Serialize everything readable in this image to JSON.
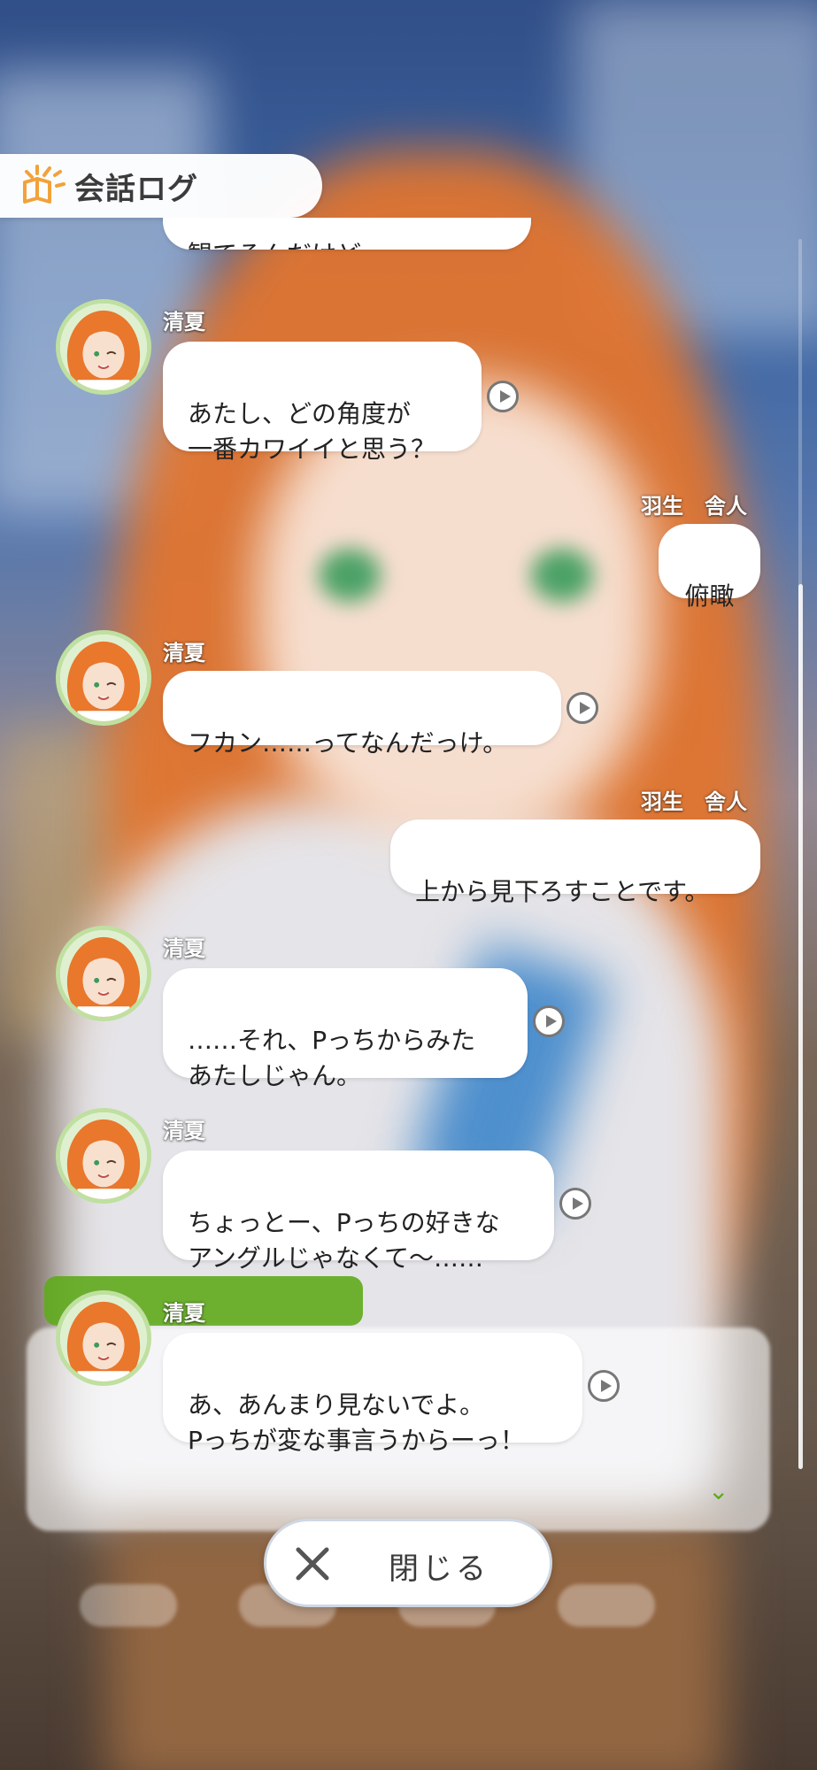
{
  "header": {
    "title": "会話ログ",
    "icon": "conversation-log-icon",
    "accent": "#f2a23a"
  },
  "messages": [
    {
      "speaker": "",
      "side": "left",
      "text": "観てるんだけど",
      "partial": true,
      "voice": false
    },
    {
      "speaker": "清夏",
      "side": "left",
      "text": "あたし、どの角度が\n一番カワイイと思う？",
      "voice": true
    },
    {
      "speaker": "羽生　舎人",
      "side": "right",
      "text": "俯瞰",
      "voice": false
    },
    {
      "speaker": "清夏",
      "side": "left",
      "text": "フカン……ってなんだっけ。",
      "voice": true
    },
    {
      "speaker": "羽生　舎人",
      "side": "right",
      "text": "上から見下ろすことです。",
      "voice": false
    },
    {
      "speaker": "清夏",
      "side": "left",
      "text": "……それ、Pっちからみた\nあたしじゃん。",
      "voice": true
    },
    {
      "speaker": "清夏",
      "side": "left",
      "text": "ちょっとー、Pっちの好きな\nアングルじゃなくて～……",
      "voice": true
    },
    {
      "speaker": "清夏",
      "side": "left",
      "text": "あ、あんまり見ないでよ。\nPっちが変な事言うからーっ！",
      "voice": true
    }
  ],
  "close_button": {
    "label": "閉じる",
    "icon": "close-icon"
  },
  "colors": {
    "avatar_ring": "#bfe0a0",
    "bubble": "#ffffff",
    "name_text": "#ffffff"
  }
}
